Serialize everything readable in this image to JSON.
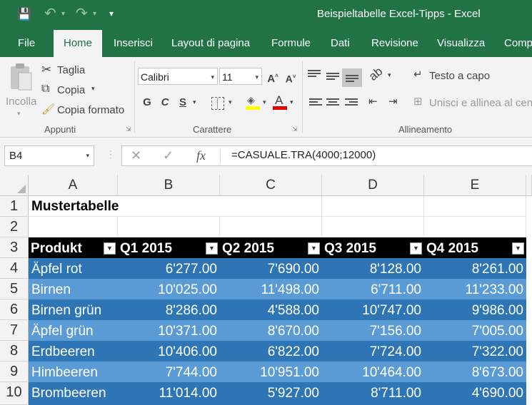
{
  "window": {
    "title": "Beispieltabelle Excel-Tipps  -  Excel",
    "qat": {
      "save_glyph": "💾",
      "undo_glyph": "↶",
      "redo_glyph": "↷",
      "customize_glyph": "▾"
    }
  },
  "tabs": [
    {
      "label": "File"
    },
    {
      "label": "Home"
    },
    {
      "label": "Inserisci"
    },
    {
      "label": "Layout di pagina"
    },
    {
      "label": "Formule"
    },
    {
      "label": "Dati"
    },
    {
      "label": "Revisione"
    },
    {
      "label": "Visualizza"
    },
    {
      "label": "Comp"
    }
  ],
  "ribbon": {
    "clipboard": {
      "paste": "Incolla",
      "cut": "Taglia",
      "copy": "Copia",
      "format_painter": "Copia formato",
      "group": "Appunti"
    },
    "font": {
      "family": "Calibri",
      "size": "11",
      "bold": "G",
      "italic": "C",
      "underline": "S",
      "group": "Carattere"
    },
    "alignment": {
      "wrap_text": "Testo a capo",
      "merge_center": "Unisci e allinea al cent",
      "group": "Allineamento"
    }
  },
  "formula_bar": {
    "name_box": "B4",
    "formula": "=CASUALE.TRA(4000;12000)",
    "fx": "fx",
    "cancel": "✕",
    "enter": "✓"
  },
  "sheet": {
    "columns": [
      "A",
      "B",
      "C",
      "D",
      "E"
    ],
    "rows": [
      "1",
      "2",
      "3",
      "4",
      "5",
      "6",
      "7",
      "8",
      "9",
      "10"
    ],
    "title": "Mustertabelle",
    "table_headers": [
      "Produkt",
      "Q1 2015",
      "Q2 2015",
      "Q3 2015",
      "Q4 2015"
    ],
    "table_rows": [
      [
        "Äpfel rot",
        "6'277.00",
        "7'690.00",
        "8'128.00",
        "8'261.00"
      ],
      [
        "Birnen",
        "10'025.00",
        "11'498.00",
        "6'711.00",
        "11'233.00"
      ],
      [
        "Birnen grün",
        "8'286.00",
        "4'588.00",
        "10'747.00",
        "9'986.00"
      ],
      [
        "Äpfel grün",
        "10'371.00",
        "8'670.00",
        "7'156.00",
        "7'005.00"
      ],
      [
        "Erdbeeren",
        "10'406.00",
        "6'822.00",
        "7'724.00",
        "7'322.00"
      ],
      [
        "Himbeeren",
        "7'744.00",
        "10'951.00",
        "10'464.00",
        "8'673.00"
      ],
      [
        "Brombeeren",
        "11'014.00",
        "5'927.00",
        "8'711.00",
        "4'690.00"
      ]
    ]
  },
  "colors": {
    "excel_green": "#217346",
    "table_header": "#000000",
    "band_dark": "#2e75b6",
    "band_light": "#5b9bd5"
  }
}
